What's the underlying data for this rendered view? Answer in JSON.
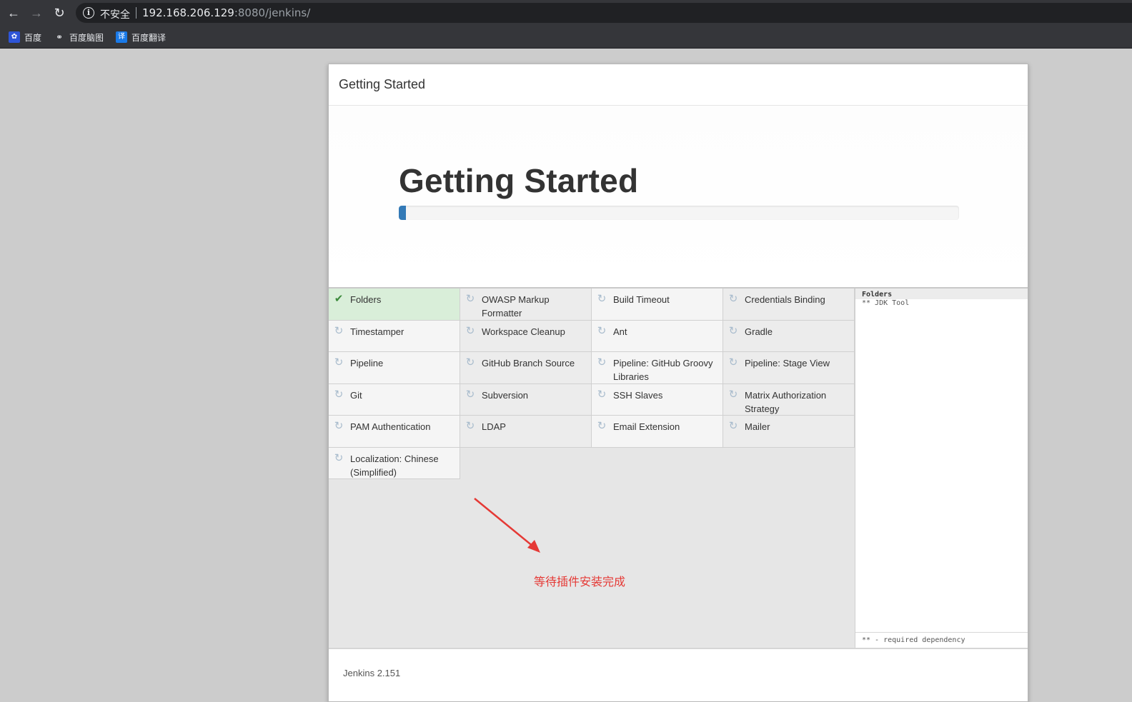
{
  "browser": {
    "insecure_label": "不安全",
    "url_host": "192.168.206.129",
    "url_rest": ":8080/jenkins/",
    "bookmarks": [
      {
        "label": "百度",
        "icon": "baidu-icon"
      },
      {
        "label": "百度脑图",
        "icon": "naotu-icon"
      },
      {
        "label": "百度翻译",
        "icon": "fanyi-icon"
      }
    ]
  },
  "dialog": {
    "header_title": "Getting Started",
    "hero_title": "Getting Started",
    "progress_percent": 1.3,
    "plugins": [
      {
        "name": "Folders",
        "status": "success"
      },
      {
        "name": "OWASP Markup Formatter",
        "status": "pending"
      },
      {
        "name": "Build Timeout",
        "status": "pending"
      },
      {
        "name": "Credentials Binding",
        "status": "pending"
      },
      {
        "name": "Timestamper",
        "status": "pending"
      },
      {
        "name": "Workspace Cleanup",
        "status": "pending"
      },
      {
        "name": "Ant",
        "status": "pending"
      },
      {
        "name": "Gradle",
        "status": "pending"
      },
      {
        "name": "Pipeline",
        "status": "pending"
      },
      {
        "name": "GitHub Branch Source",
        "status": "pending"
      },
      {
        "name": "Pipeline: GitHub Groovy Libraries",
        "status": "pending"
      },
      {
        "name": "Pipeline: Stage View",
        "status": "pending"
      },
      {
        "name": "Git",
        "status": "pending"
      },
      {
        "name": "Subversion",
        "status": "pending"
      },
      {
        "name": "SSH Slaves",
        "status": "pending"
      },
      {
        "name": "Matrix Authorization Strategy",
        "status": "pending"
      },
      {
        "name": "PAM Authentication",
        "status": "pending"
      },
      {
        "name": "LDAP",
        "status": "pending"
      },
      {
        "name": "Email Extension",
        "status": "pending"
      },
      {
        "name": "Mailer",
        "status": "pending"
      },
      {
        "name": "Localization: Chinese (Simplified)",
        "status": "pending"
      }
    ],
    "log": {
      "line1": "Folders",
      "line2": "** JDK Tool",
      "footer": "** - required dependency"
    },
    "annotation": "等待插件安装完成",
    "footer_version": "Jenkins 2.151"
  },
  "colors": {
    "progress": "#337ab7",
    "success_bg": "#d9eed9",
    "annotation": "#e53935"
  }
}
